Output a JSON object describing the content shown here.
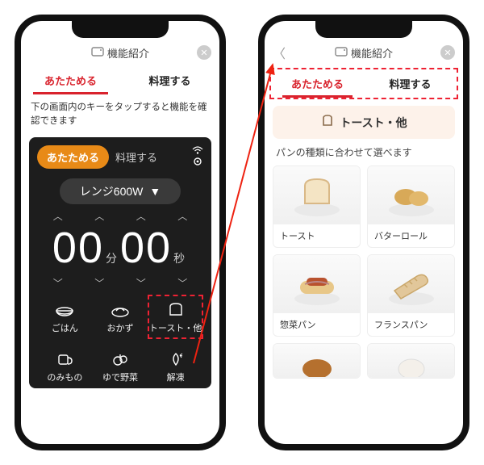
{
  "header": {
    "title": "機能紹介"
  },
  "tabs": {
    "left": "あたためる",
    "right": "料理する"
  },
  "left": {
    "hint": "下の画面内のキーをタップすると機能を確認できます",
    "sim": {
      "heat": "あたためる",
      "cook": "料理する",
      "power": "レンジ600W",
      "time": {
        "mm": "00",
        "min_unit": "分",
        "ss": "00",
        "sec_unit": "秒"
      },
      "cats_row1": [
        "ごはん",
        "おかず",
        "トースト・他"
      ],
      "cats_row2": [
        "のみもの",
        "ゆで野菜",
        "解凍"
      ]
    }
  },
  "right": {
    "banner": "トースト・他",
    "note": "パンの種類に合わせて選べます",
    "items": [
      "トースト",
      "バターロール",
      "惣菜パン",
      "フランスパン"
    ]
  }
}
